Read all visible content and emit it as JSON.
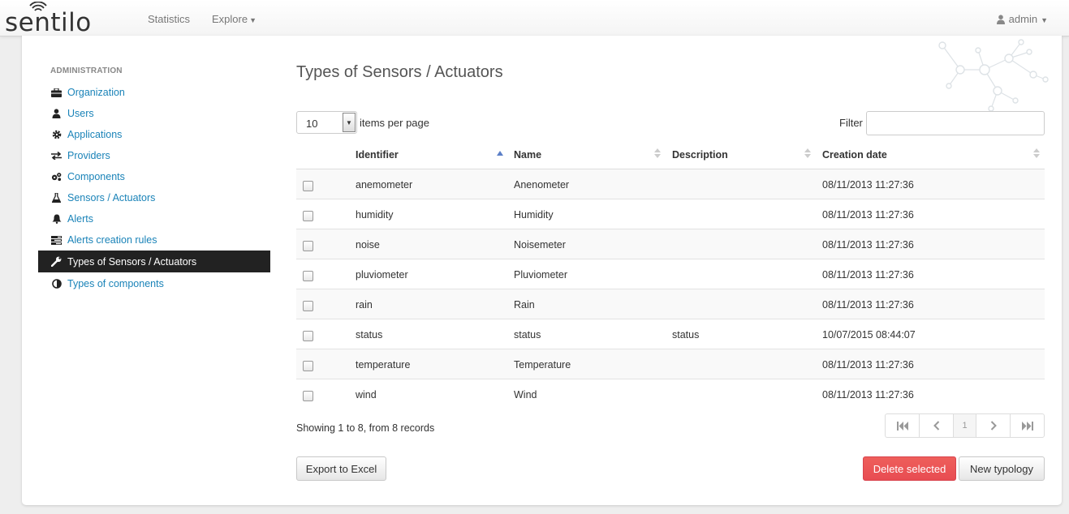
{
  "brand": {
    "name": "sentilo"
  },
  "nav": {
    "statistics": "Statistics",
    "explore": "Explore",
    "user": "admin"
  },
  "sidebar": {
    "header": "ADMINISTRATION",
    "items": [
      {
        "label": "Organization",
        "icon": "briefcase-icon"
      },
      {
        "label": "Users",
        "icon": "user-icon"
      },
      {
        "label": "Applications",
        "icon": "gear-icon"
      },
      {
        "label": "Providers",
        "icon": "exchange-icon"
      },
      {
        "label": "Components",
        "icon": "gears-icon"
      },
      {
        "label": "Sensors / Actuators",
        "icon": "flask-icon"
      },
      {
        "label": "Alerts",
        "icon": "bell-icon"
      },
      {
        "label": "Alerts creation rules",
        "icon": "tasks-icon"
      },
      {
        "label": "Types of Sensors / Actuators",
        "icon": "wrench-icon",
        "active": true
      },
      {
        "label": "Types of components",
        "icon": "adjust-icon"
      }
    ]
  },
  "main": {
    "title": "Types of Sensors / Actuators",
    "page_size": "10",
    "page_size_label": "items per page",
    "filter_label": "Filter",
    "filter_value": "",
    "columns": [
      "Identifier",
      "Name",
      "Description",
      "Creation date"
    ],
    "rows": [
      [
        "anemometer",
        "Anenometer",
        "",
        "08/11/2013 11:27:36"
      ],
      [
        "humidity",
        "Humidity",
        "",
        "08/11/2013 11:27:36"
      ],
      [
        "noise",
        "Noisemeter",
        "",
        "08/11/2013 11:27:36"
      ],
      [
        "pluviometer",
        "Pluviometer",
        "",
        "08/11/2013 11:27:36"
      ],
      [
        "rain",
        "Rain",
        "",
        "08/11/2013 11:27:36"
      ],
      [
        "status",
        "status",
        "status",
        "10/07/2015 08:44:07"
      ],
      [
        "temperature",
        "Temperature",
        "",
        "08/11/2013 11:27:36"
      ],
      [
        "wind",
        "Wind",
        "",
        "08/11/2013 11:27:36"
      ]
    ],
    "showing": "Showing 1 to 8, from 8 records",
    "current_page": "1",
    "export_label": "Export to Excel",
    "delete_label": "Delete selected",
    "new_label": "New typology"
  },
  "colors": {
    "link": "#1a83b8",
    "active_bg": "#222222",
    "danger": "#e84c52",
    "sort_active": "#5b7fc7"
  }
}
